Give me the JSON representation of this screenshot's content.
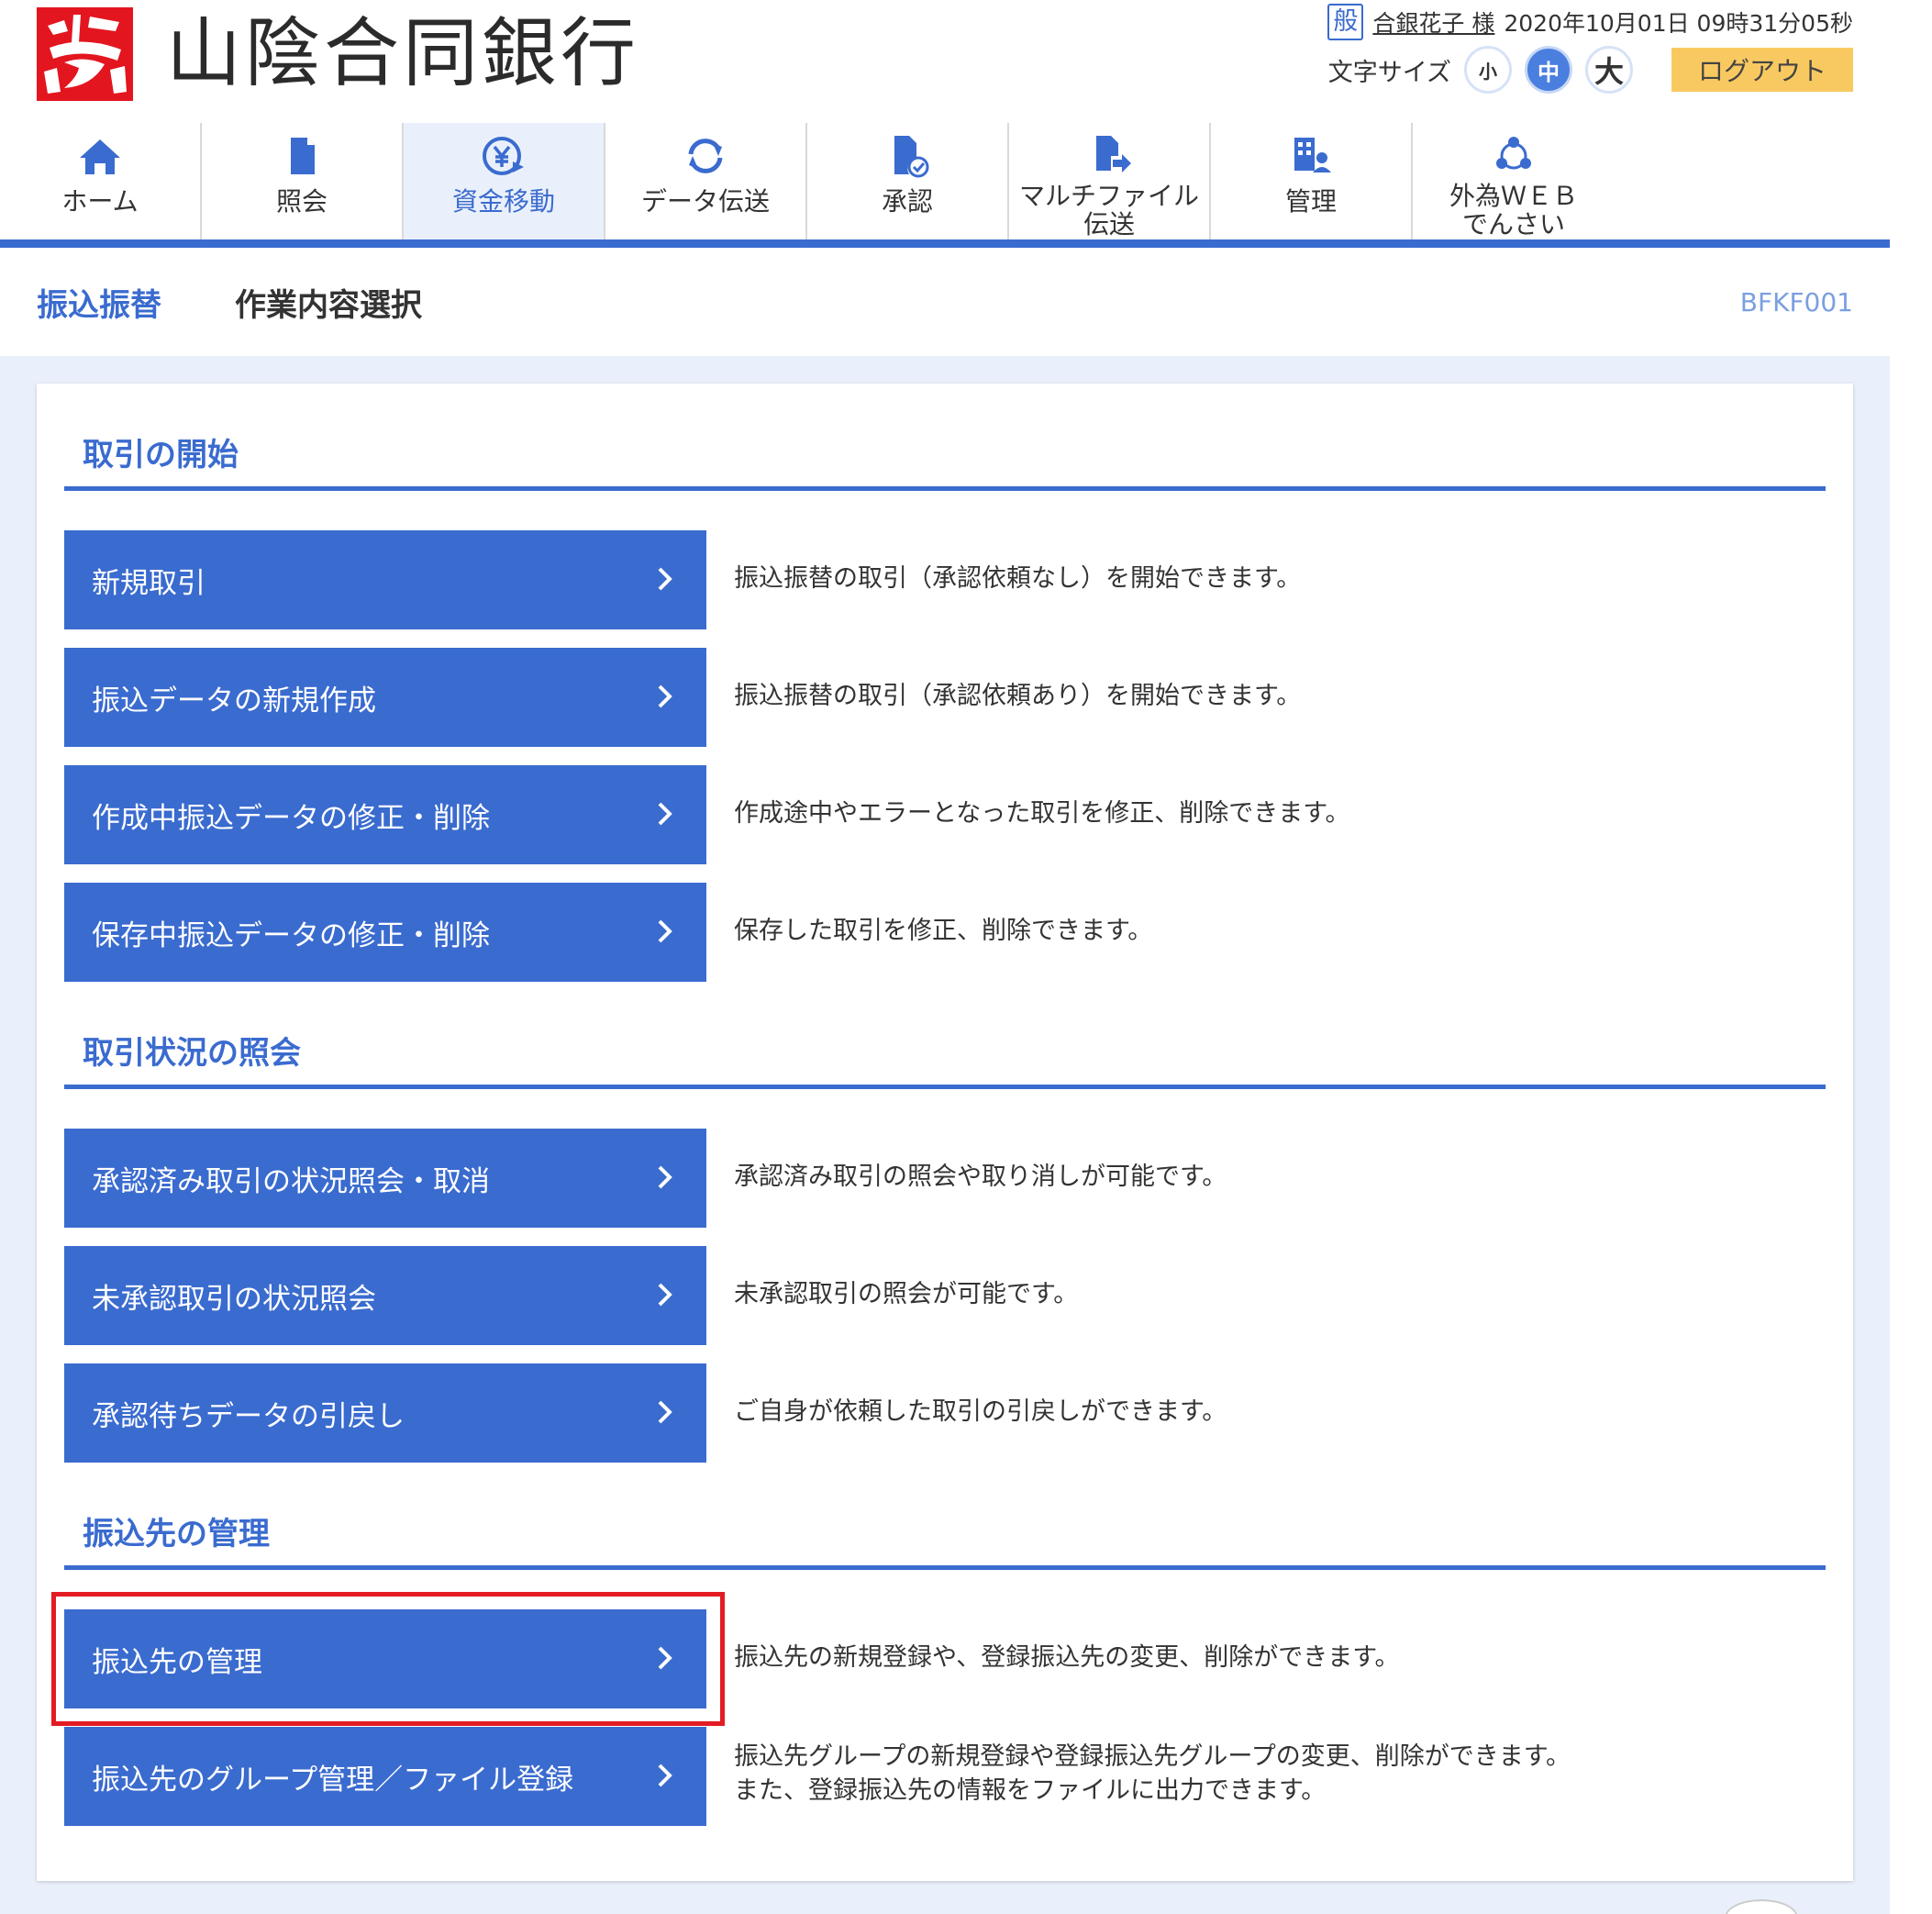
{
  "header": {
    "bank_name": "山陰合同銀行",
    "user_badge": "般",
    "user_name": "合銀花子 様",
    "datetime": "2020年10月01日 09時31分05秒",
    "font_size_label": "文字サイズ",
    "font_sizes": [
      "小",
      "中",
      "大"
    ],
    "logout_label": "ログアウト"
  },
  "nav": {
    "items": [
      {
        "label": "ホーム",
        "icon": "home-icon"
      },
      {
        "label": "照会",
        "icon": "document-icon"
      },
      {
        "label": "資金移動",
        "icon": "yen-transfer-icon"
      },
      {
        "label": "データ伝送",
        "icon": "sync-icon"
      },
      {
        "label": "承認",
        "icon": "approve-document-icon"
      },
      {
        "label": "マルチファイル",
        "label2": "伝送",
        "icon": "file-upload-icon"
      },
      {
        "label": "管理",
        "icon": "building-user-icon"
      },
      {
        "label": "外為ＷＥＢ",
        "label2": "でんさい",
        "icon": "network-icon"
      }
    ],
    "active": "資金移動"
  },
  "title": {
    "main": "振込振替",
    "sub": "作業内容選択",
    "screen_id": "BFKF001"
  },
  "sections": [
    {
      "title": "取引の開始",
      "actions": [
        {
          "label": "新規取引",
          "desc": "振込振替の取引（承認依頼なし）を開始できます。"
        },
        {
          "label": "振込データの新規作成",
          "desc": "振込振替の取引（承認依頼あり）を開始できます。"
        },
        {
          "label": "作成中振込データの修正・削除",
          "desc": "作成途中やエラーとなった取引を修正、削除できます。"
        },
        {
          "label": "保存中振込データの修正・削除",
          "desc": "保存した取引を修正、削除できます。"
        }
      ]
    },
    {
      "title": "取引状況の照会",
      "actions": [
        {
          "label": "承認済み取引の状況照会・取消",
          "desc": "承認済み取引の照会や取り消しが可能です。"
        },
        {
          "label": "未承認取引の状況照会",
          "desc": "未承認取引の照会が可能です。"
        },
        {
          "label": "承認待ちデータの引戻し",
          "desc": "ご自身が依頼した取引の引戻しができます。"
        }
      ]
    },
    {
      "title": "振込先の管理",
      "actions": [
        {
          "label": "振込先の管理",
          "desc": "振込先の新規登録や、登録振込先の変更、削除ができます。"
        },
        {
          "label": "振込先のグループ管理／ファイル登録",
          "desc": "振込先グループの新規登録や登録振込先グループの変更、削除ができます。",
          "desc2": "また、登録振込先の情報をファイルに出力できます。"
        }
      ]
    }
  ],
  "colors": {
    "accent": "#3a6bcf",
    "brand_red": "#e3151f",
    "logout": "#f9c961",
    "page_bg": "#eaf0fb",
    "highlight": "#e31b23"
  }
}
